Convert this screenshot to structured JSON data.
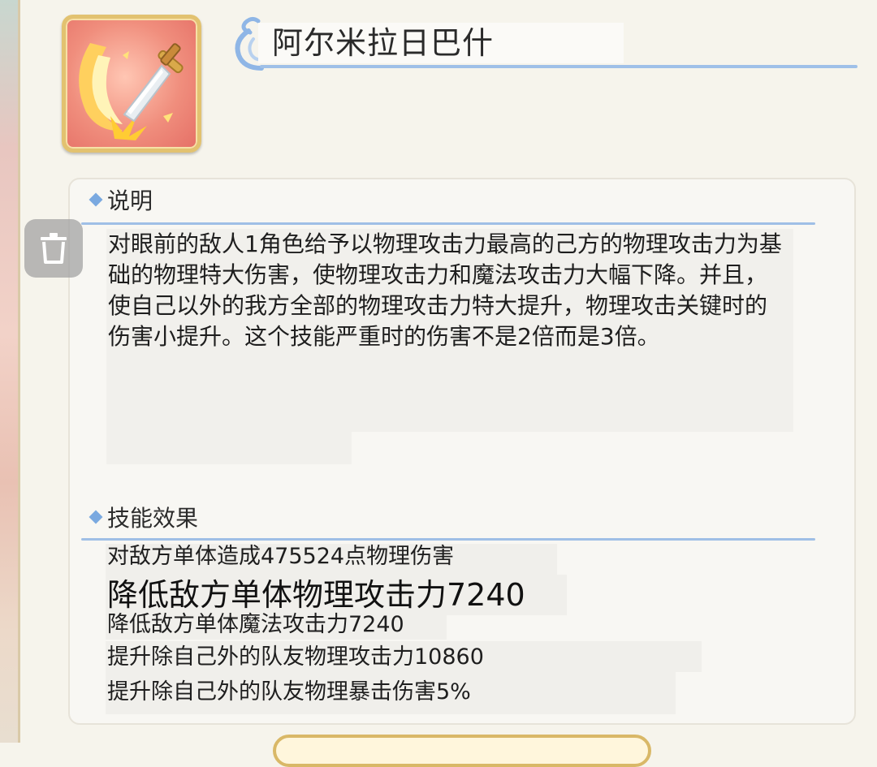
{
  "skill": {
    "name": "阿尔米拉日巴什",
    "icon": "sword-slash-icon"
  },
  "description": {
    "heading": "说明",
    "text": "对眼前的敌人1角色给予以物理攻击力最高的己方的物理攻击力为基础的物理特大伤害，使物理攻击力和魔法攻击力大幅下降。并且，使自己以外的我方全部的物理攻击力特大提升，物理攻击关键时的伤害小提升。这个技能严重时的伤害不是2倍而是3倍。"
  },
  "effects": {
    "heading": "技能效果",
    "lines": [
      "对敌方单体造成475524点物理伤害",
      "降低敌方单体物理攻击力7240",
      "降低敌方单体魔法攻击力7240",
      "提升除自己外的队友物理攻击力10860",
      "提升除自己外的队友物理暴击伤害5%"
    ]
  },
  "colors": {
    "accent_line": "#9fc0e8",
    "icon_border": "#e2c270",
    "icon_bg": "#f08e7d"
  }
}
